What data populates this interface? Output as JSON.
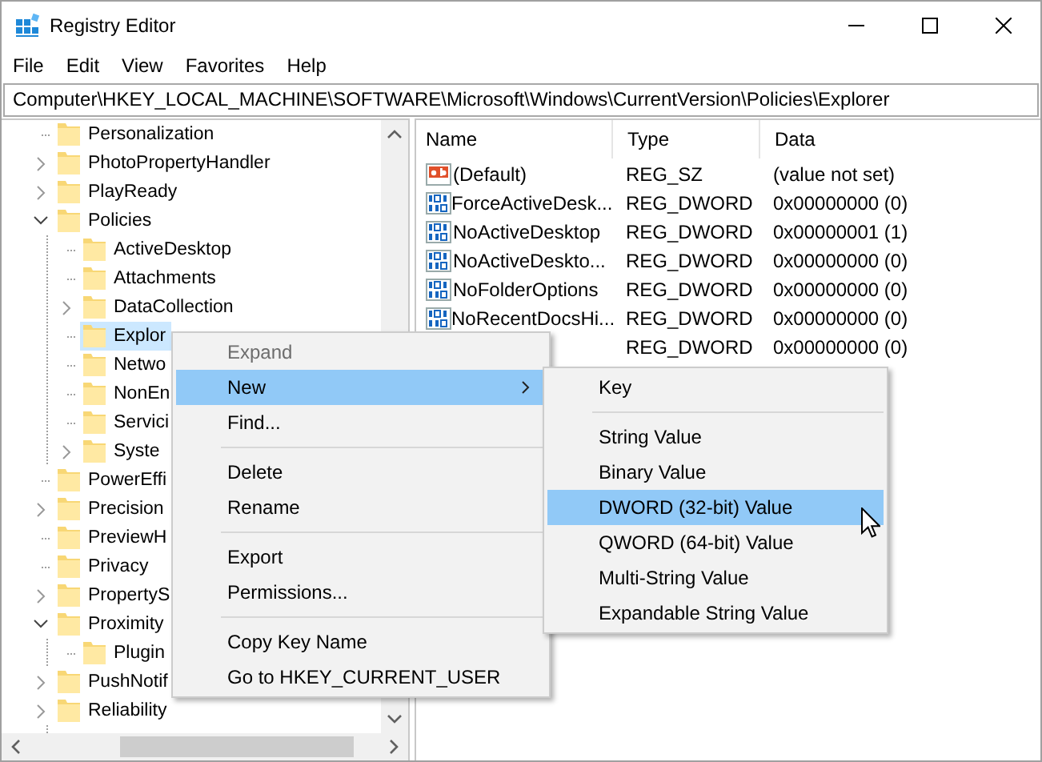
{
  "window": {
    "title": "Registry Editor"
  },
  "menu_bar": [
    "File",
    "Edit",
    "View",
    "Favorites",
    "Help"
  ],
  "address": {
    "value": "Computer\\HKEY_LOCAL_MACHINE\\SOFTWARE\\Microsoft\\Windows\\CurrentVersion\\Policies\\Explorer"
  },
  "tree": [
    {
      "label": "Personalization",
      "kind": "leaf",
      "selected": false
    },
    {
      "label": "PhotoPropertyHandler",
      "kind": "branch",
      "expanded": false,
      "selected": false
    },
    {
      "label": "PlayReady",
      "kind": "branch",
      "expanded": false,
      "selected": false
    },
    {
      "label": "Policies",
      "kind": "branch",
      "expanded": true,
      "selected": false,
      "children": [
        {
          "label": "ActiveDesktop",
          "kind": "leaf",
          "selected": false
        },
        {
          "label": "Attachments",
          "kind": "leaf",
          "selected": false
        },
        {
          "label": "DataCollection",
          "kind": "branch",
          "expanded": false,
          "selected": false
        },
        {
          "label": "Explor",
          "kind": "leaf",
          "selected": true
        },
        {
          "label": "Netwo",
          "kind": "leaf",
          "selected": false
        },
        {
          "label": "NonEn",
          "kind": "leaf",
          "selected": false
        },
        {
          "label": "Servici",
          "kind": "leaf",
          "selected": false
        },
        {
          "label": "Syste",
          "kind": "branch",
          "expanded": false,
          "selected": false
        }
      ]
    },
    {
      "label": "PowerEffi",
      "kind": "leaf",
      "selected": false
    },
    {
      "label": "Precision",
      "kind": "branch",
      "expanded": false,
      "selected": false
    },
    {
      "label": "PreviewH",
      "kind": "leaf",
      "selected": false
    },
    {
      "label": "Privacy",
      "kind": "leaf",
      "selected": false
    },
    {
      "label": "PropertyS",
      "kind": "branch",
      "expanded": false,
      "selected": false
    },
    {
      "label": "Proximity",
      "kind": "branch",
      "expanded": true,
      "selected": false,
      "children": [
        {
          "label": "Plugin",
          "kind": "leaf",
          "selected": false
        }
      ]
    },
    {
      "label": "PushNotif",
      "kind": "branch",
      "expanded": false,
      "selected": false
    },
    {
      "label": "Reliability",
      "kind": "branch",
      "expanded": false,
      "selected": false
    }
  ],
  "values": {
    "columns": [
      "Name",
      "Type",
      "Data"
    ],
    "rows": [
      {
        "kind": "string",
        "name": "(Default)",
        "type": "REG_SZ",
        "data": "(value not set)"
      },
      {
        "kind": "dword",
        "name": "ForceActiveDesk...",
        "type": "REG_DWORD",
        "data": "0x00000000 (0)"
      },
      {
        "kind": "dword",
        "name": "NoActiveDesktop",
        "type": "REG_DWORD",
        "data": "0x00000001 (1)"
      },
      {
        "kind": "dword",
        "name": "NoActiveDeskto...",
        "type": "REG_DWORD",
        "data": "0x00000000 (0)"
      },
      {
        "kind": "dword",
        "name": "NoFolderOptions",
        "type": "REG_DWORD",
        "data": "0x00000000 (0)"
      },
      {
        "kind": "dword",
        "name": "NoRecentDocsHi...",
        "type": "REG_DWORD",
        "data": "0x00000000 (0)"
      },
      {
        "type": "REG_DWORD",
        "data": "0x00000000 (0)"
      }
    ]
  },
  "context_menu": {
    "items": [
      {
        "kind": "item",
        "label": "Expand",
        "disabled": true,
        "selected": false,
        "submenu": false
      },
      {
        "kind": "item",
        "label": "New",
        "disabled": false,
        "selected": true,
        "submenu": true
      },
      {
        "kind": "item",
        "label": "Find...",
        "disabled": false,
        "selected": false,
        "submenu": false
      },
      {
        "kind": "separator"
      },
      {
        "kind": "item",
        "label": "Delete",
        "disabled": false,
        "selected": false,
        "submenu": false
      },
      {
        "kind": "item",
        "label": "Rename",
        "disabled": false,
        "selected": false,
        "submenu": false
      },
      {
        "kind": "separator"
      },
      {
        "kind": "item",
        "label": "Export",
        "disabled": false,
        "selected": false,
        "submenu": false
      },
      {
        "kind": "item",
        "label": "Permissions...",
        "disabled": false,
        "selected": false,
        "submenu": false
      },
      {
        "kind": "separator"
      },
      {
        "kind": "item",
        "label": "Copy Key Name",
        "disabled": false,
        "selected": false,
        "submenu": false
      },
      {
        "kind": "item",
        "label": "Go to HKEY_CURRENT_USER",
        "disabled": false,
        "selected": false,
        "submenu": false
      }
    ]
  },
  "submenu": {
    "items": [
      {
        "kind": "item",
        "label": "Key",
        "selected": false
      },
      {
        "kind": "separator"
      },
      {
        "kind": "item",
        "label": "String Value",
        "selected": false
      },
      {
        "kind": "item",
        "label": "Binary Value",
        "selected": false
      },
      {
        "kind": "item",
        "label": "DWORD (32-bit) Value",
        "selected": true
      },
      {
        "kind": "item",
        "label": "QWORD (64-bit) Value",
        "selected": false
      },
      {
        "kind": "item",
        "label": "Multi-String Value",
        "selected": false
      },
      {
        "kind": "item",
        "label": "Expandable String Value",
        "selected": false
      }
    ]
  }
}
